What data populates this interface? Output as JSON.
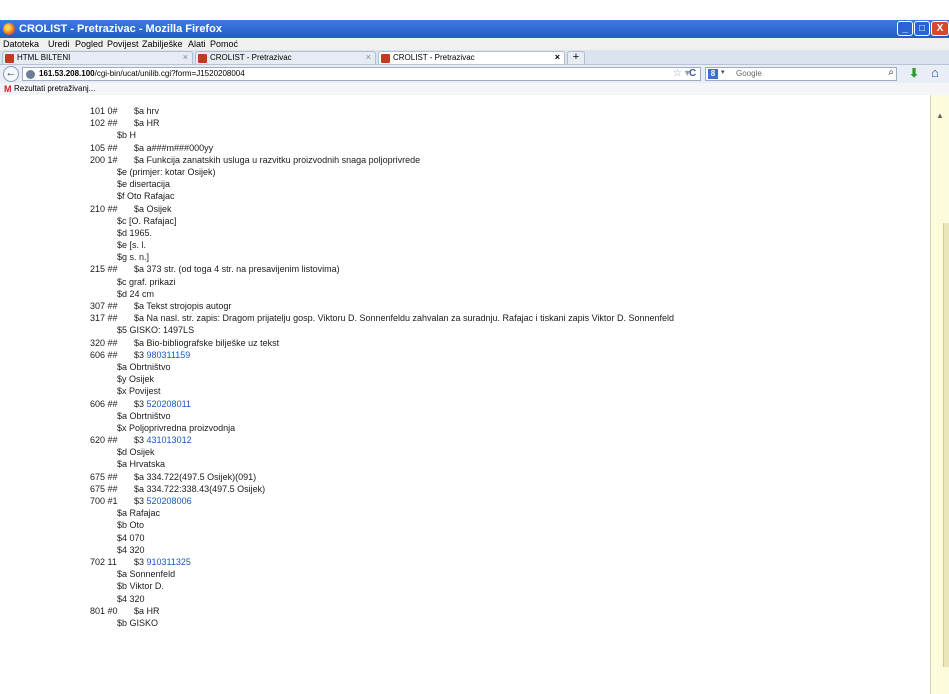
{
  "window": {
    "title": "CROLIST - Pretrazivac - Mozilla Firefox",
    "min": "_",
    "max": "□",
    "close": "X"
  },
  "menu": [
    "Datoteka",
    "Uredi",
    "Pogled",
    "Povijest",
    "Zabilješke",
    "Alati",
    "Pomoć"
  ],
  "tabs": [
    {
      "label": "HTML BILTENI",
      "close": "×"
    },
    {
      "label": "CROLIST - Pretrazivac",
      "close": "×"
    },
    {
      "label": "CROLIST - Pretrazivac",
      "close": "×"
    }
  ],
  "newtab": "+",
  "nav": {
    "back": "←",
    "url_host": "161.53.208.100",
    "url_path": "/cgi-bin/ucat/unilib.cgi?form=J1520208004",
    "star": "☆ ▾",
    "reload": "C",
    "search_engine": "Google",
    "search_icon": "⌕",
    "download_icon": "⬇",
    "home_icon": "⌂"
  },
  "bookmarks": {
    "item": "Rezultati pretraživanj..."
  },
  "record": [
    {
      "tag": "101 0#",
      "code": "$a",
      "val": "hrv",
      "kind": "first"
    },
    {
      "tag": "102 ##",
      "code": "$a",
      "val": "HR",
      "kind": "first"
    },
    {
      "tag": "",
      "code": "$b",
      "val": "H",
      "kind": "indent"
    },
    {
      "tag": "105 ##",
      "code": "$a",
      "val": "a###m###000yy",
      "kind": "first"
    },
    {
      "tag": "200 1#",
      "code": "$a",
      "val": "Funkcija zanatskih usluga u razvitku proizvodnih snaga poljoprivrede",
      "kind": "first"
    },
    {
      "tag": "",
      "code": "$e",
      "val": "(primjer: kotar Osijek)",
      "kind": "indent"
    },
    {
      "tag": "",
      "code": "$e",
      "val": "disertacija",
      "kind": "indent"
    },
    {
      "tag": "",
      "code": "$f",
      "val": "Oto Rafajac",
      "kind": "indent"
    },
    {
      "tag": "210 ##",
      "code": "$a",
      "val": "Osijek",
      "kind": "first"
    },
    {
      "tag": "",
      "code": "$c",
      "val": "[O. Rafajac]",
      "kind": "indent"
    },
    {
      "tag": "",
      "code": "$d",
      "val": "1965.",
      "kind": "indent"
    },
    {
      "tag": "",
      "code": "$e",
      "val": "[s. l.",
      "kind": "indent"
    },
    {
      "tag": "",
      "code": "$g",
      "val": "s. n.]",
      "kind": "indent"
    },
    {
      "tag": "215 ##",
      "code": "$a",
      "val": "373 str. (od toga 4 str. na presavijenim listovima)",
      "kind": "first"
    },
    {
      "tag": "",
      "code": "$c",
      "val": "graf. prikazi",
      "kind": "indent"
    },
    {
      "tag": "",
      "code": "$d",
      "val": "24 cm",
      "kind": "indent"
    },
    {
      "tag": "307 ##",
      "code": "$a",
      "val": "Tekst strojopis autogr",
      "kind": "first"
    },
    {
      "tag": "317 ##",
      "code": "$a",
      "val": "Na nasl. str. zapis: Dragom prijatelju gosp. Viktoru D. Sonnenfeldu zahvalan za suradnju. Rafajac i tiskani zapis Viktor D. Sonnenfeld",
      "kind": "first"
    },
    {
      "tag": "",
      "code": "$5",
      "val": "GISKO: 1497LS",
      "kind": "indent"
    },
    {
      "tag": "320 ##",
      "code": "$a",
      "val": "Bio-bibliografske bilješke uz tekst",
      "kind": "first"
    },
    {
      "tag": "606 ##",
      "code": "$3",
      "val": "980311159",
      "kind": "first",
      "link": true
    },
    {
      "tag": "",
      "code": "$a",
      "val": "Obrtništvo",
      "kind": "indent"
    },
    {
      "tag": "",
      "code": "$y",
      "val": "Osijek",
      "kind": "indent"
    },
    {
      "tag": "",
      "code": "$x",
      "val": "Povijest",
      "kind": "indent"
    },
    {
      "tag": "606 ##",
      "code": "$3",
      "val": "520208011",
      "kind": "first",
      "link": true
    },
    {
      "tag": "",
      "code": "$a",
      "val": "Obrtništvo",
      "kind": "indent"
    },
    {
      "tag": "",
      "code": "$x",
      "val": "Poljoprivredna proizvodnja",
      "kind": "indent"
    },
    {
      "tag": "620 ##",
      "code": "$3",
      "val": "431013012",
      "kind": "first",
      "link": true
    },
    {
      "tag": "",
      "code": "$d",
      "val": "Osijek",
      "kind": "indent"
    },
    {
      "tag": "",
      "code": "$a",
      "val": "Hrvatska",
      "kind": "indent"
    },
    {
      "tag": "675 ##",
      "code": "$a",
      "val": "334.722(497.5 Osijek)(091)",
      "kind": "first"
    },
    {
      "tag": "675 ##",
      "code": "$a",
      "val": "334.722:338.43(497.5 Osijek)",
      "kind": "first"
    },
    {
      "tag": "700 #1",
      "code": "$3",
      "val": "520208006",
      "kind": "first",
      "link": true
    },
    {
      "tag": "",
      "code": "$a",
      "val": "Rafajac",
      "kind": "indent"
    },
    {
      "tag": "",
      "code": "$b",
      "val": "Oto",
      "kind": "indent"
    },
    {
      "tag": "",
      "code": "$4",
      "val": "070",
      "kind": "indent"
    },
    {
      "tag": "",
      "code": "$4",
      "val": "320",
      "kind": "indent"
    },
    {
      "tag": "702 11",
      "code": "$3",
      "val": "910311325",
      "kind": "first",
      "link": true
    },
    {
      "tag": "",
      "code": "$a",
      "val": "Sonnenfeld",
      "kind": "indent"
    },
    {
      "tag": "",
      "code": "$b",
      "val": "Viktor D.",
      "kind": "indent"
    },
    {
      "tag": "",
      "code": "$4",
      "val": "320",
      "kind": "indent"
    },
    {
      "tag": "801 #0",
      "code": "$a",
      "val": "HR",
      "kind": "first"
    },
    {
      "tag": "",
      "code": "$b",
      "val": "GISKO",
      "kind": "indent"
    }
  ]
}
